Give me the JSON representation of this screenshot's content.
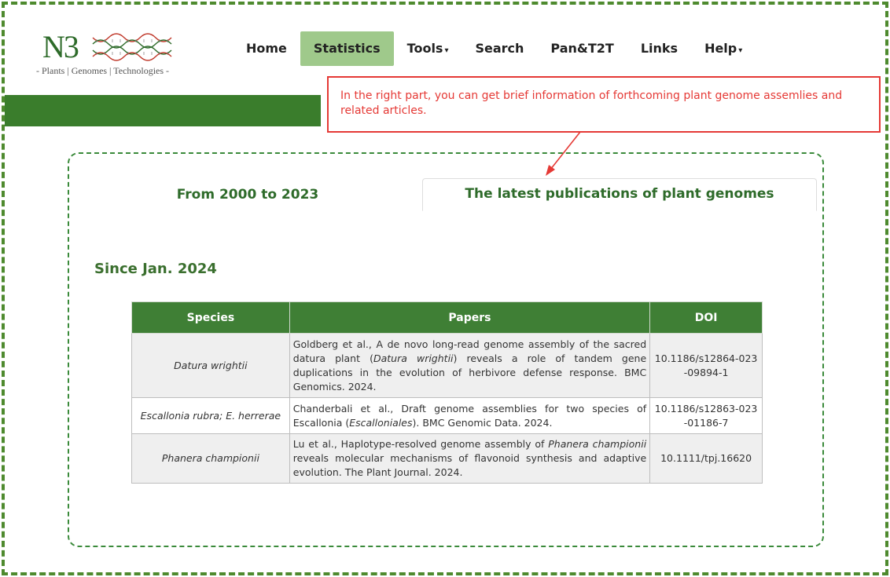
{
  "logo": {
    "mark": "N3",
    "tagline": "- Plants | Genomes | Technologies -"
  },
  "nav": [
    {
      "label": "Home",
      "dropdown": false
    },
    {
      "label": "Statistics",
      "dropdown": false,
      "active": true
    },
    {
      "label": "Tools",
      "dropdown": true
    },
    {
      "label": "Search",
      "dropdown": false
    },
    {
      "label": "Pan&T2T",
      "dropdown": false
    },
    {
      "label": "Links",
      "dropdown": false
    },
    {
      "label": "Help",
      "dropdown": true
    }
  ],
  "callout": {
    "text": "In the right part, you can get brief information of forthcoming plant genome assemlies and related articles."
  },
  "tabs": {
    "left": "From 2000 to 2023",
    "right": "The latest publications of plant genomes"
  },
  "section_title": "Since Jan. 2024",
  "table": {
    "headers": [
      "Species",
      "Papers",
      "DOI"
    ],
    "rows": [
      {
        "species": "Datura wrightii",
        "paper_before": "Goldberg et al., A de novo long-read genome assembly of the sacred datura plant (",
        "paper_italic": "Datura wrightii",
        "paper_after": ") reveals a role of tandem gene duplications in the evolution of herbivore defense response. BMC Genomics. 2024.",
        "doi": "10.1186/s12864-023-09894-1"
      },
      {
        "species": "Escallonia rubra; E. herrerae",
        "paper_before": "Chanderbali et al., Draft genome assemblies for two species of Escallonia (",
        "paper_italic": "Escalloniales",
        "paper_after": "). BMC Genomic Data. 2024.",
        "doi": "10.1186/s12863-023-01186-7"
      },
      {
        "species": "Phanera championii",
        "paper_before": "Lu et al., Haplotype-resolved genome assembly of ",
        "paper_italic": "Phanera championii",
        "paper_after": " reveals molecular mechanisms of flavonoid synthesis and adaptive evolution. The Plant Journal. 2024.",
        "doi": "10.1111/tpj.16620"
      }
    ]
  },
  "colors": {
    "brand_green": "#3a7d2c",
    "active_nav": "#9fc98b",
    "table_header": "#3f7f35",
    "callout_red": "#e53935"
  }
}
